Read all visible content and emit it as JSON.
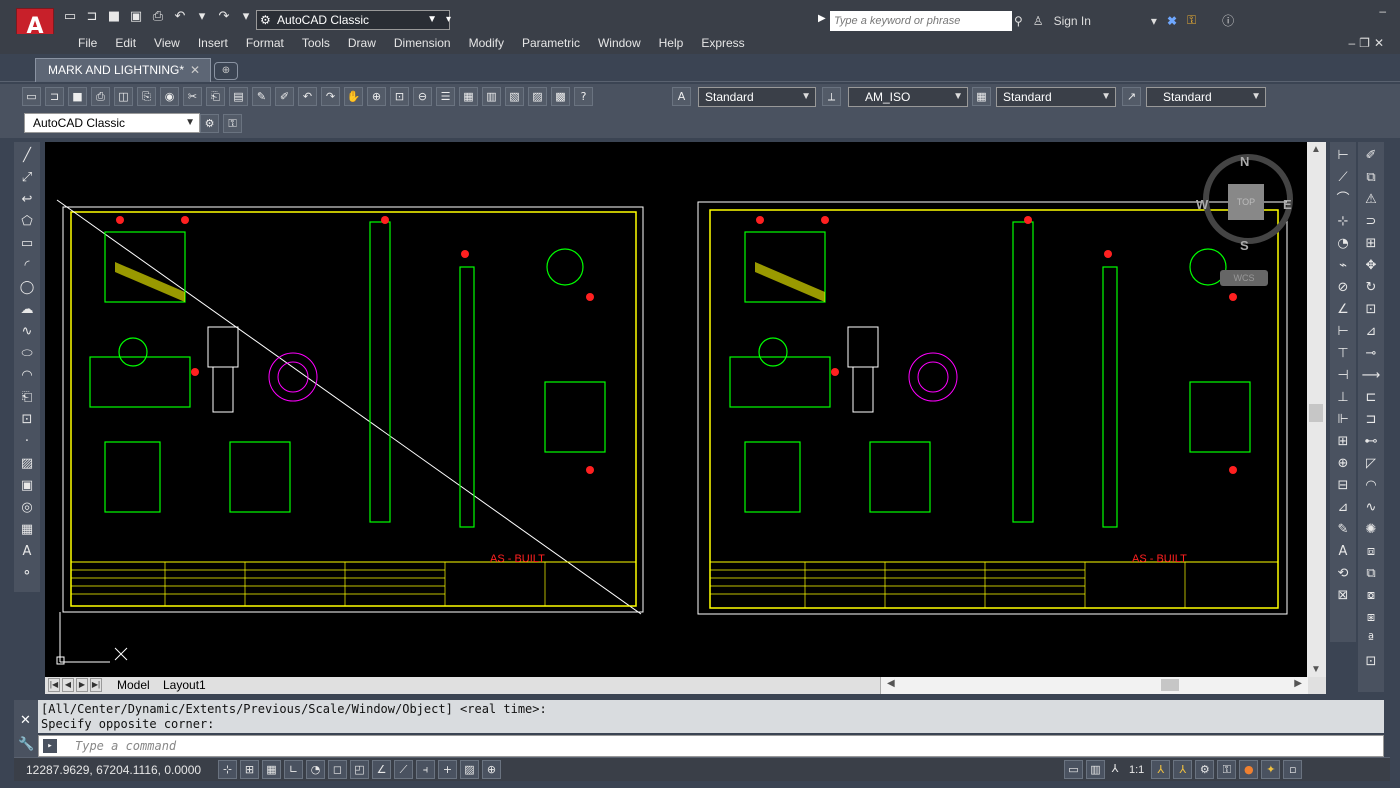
{
  "app": {
    "logo_letter": "A",
    "workspace": "AutoCAD Classic",
    "search_placeholder": "Type a keyword or phrase",
    "sign_in": "Sign In"
  },
  "menu": [
    "File",
    "Edit",
    "View",
    "Insert",
    "Format",
    "Tools",
    "Draw",
    "Dimension",
    "Modify",
    "Parametric",
    "Window",
    "Help",
    "Express"
  ],
  "tabs": {
    "document": "MARK AND LIGHTNING*"
  },
  "styles": {
    "text_style": "Standard",
    "dim_style": "AM_ISO",
    "table_style": "Standard",
    "mleader_style": "Standard"
  },
  "workspace_toolbar": {
    "selected": "AutoCAD Classic"
  },
  "layouts": {
    "model": "Model",
    "layout1": "Layout1"
  },
  "command": {
    "history_line1": "[All/Center/Dynamic/Extents/Previous/Scale/Window/Object] <real time>:",
    "history_line2": "Specify opposite corner:",
    "input_placeholder": "Type a command"
  },
  "status": {
    "coordinates": "12287.9629, 67204.1116, 0.0000",
    "annotation_scale": "1:1"
  },
  "viewcube": {
    "top": "TOP",
    "n": "N",
    "s": "S",
    "e": "E",
    "w": "W",
    "wcs": "WCS"
  },
  "drawing": {
    "stamp_left": "AS - BUILT",
    "stamp_right": "AS - BUILT",
    "colors": {
      "frame": "#ffff00",
      "lines": "#00ff00",
      "red": "#ff2020",
      "cyan": "#00ffff",
      "magenta": "#ff00ff",
      "white": "#ffffff"
    }
  }
}
